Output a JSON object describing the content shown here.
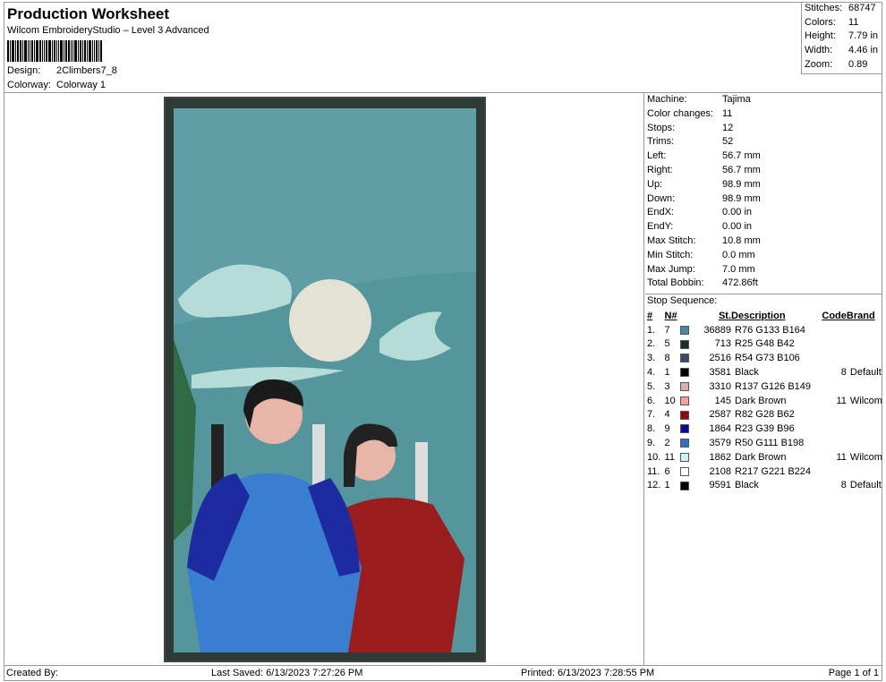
{
  "header": {
    "title": "Production Worksheet",
    "subtitle": "Wilcom EmbroideryStudio – Level 3 Advanced",
    "design_label": "Design:",
    "design": "2Climbers7_8",
    "colorway_label": "Colorway:",
    "colorway": "Colorway 1"
  },
  "stats": [
    {
      "label": "Stitches:",
      "value": "68747"
    },
    {
      "label": "Colors:",
      "value": "11"
    },
    {
      "label": "Height:",
      "value": "7.79 in"
    },
    {
      "label": "Width:",
      "value": "4.46 in"
    },
    {
      "label": "Zoom:",
      "value": "0.89"
    }
  ],
  "info": [
    {
      "label": "Machine:",
      "value": "Tajima"
    },
    {
      "label": "Color changes:",
      "value": "11"
    },
    {
      "label": "Stops:",
      "value": "12"
    },
    {
      "label": "Trims:",
      "value": "52"
    },
    {
      "label": "Left:",
      "value": "56.7 mm"
    },
    {
      "label": "Right:",
      "value": "56.7 mm"
    },
    {
      "label": "Up:",
      "value": "98.9 mm"
    },
    {
      "label": "Down:",
      "value": "98.9 mm"
    },
    {
      "label": "EndX:",
      "value": "0.00 in"
    },
    {
      "label": "EndY:",
      "value": "0.00 in"
    },
    {
      "label": "Max Stitch:",
      "value": "10.8 mm"
    },
    {
      "label": "Min Stitch:",
      "value": "0.0 mm"
    },
    {
      "label": "Max Jump:",
      "value": "7.0 mm"
    },
    {
      "label": "Total Bobbin:",
      "value": "472.86ft"
    }
  ],
  "stop_sequence": {
    "title": "Stop Sequence:",
    "columns": [
      "#",
      "N#",
      "St.",
      "Description",
      "Code",
      "Brand"
    ],
    "rows": [
      {
        "num": "1.",
        "n": "7",
        "color": "#4c85a4",
        "st": "36889",
        "desc": "R76 G133 B164",
        "code": "",
        "brand": ""
      },
      {
        "num": "2.",
        "n": "5",
        "color": "#19302a",
        "st": "713",
        "desc": "R25 G48 B42",
        "code": "",
        "brand": ""
      },
      {
        "num": "3.",
        "n": "8",
        "color": "#36496a",
        "st": "2516",
        "desc": "R54 G73 B106",
        "code": "",
        "brand": ""
      },
      {
        "num": "4.",
        "n": "1",
        "color": "#000000",
        "st": "3581",
        "desc": "Black",
        "code": "8",
        "brand": "Default"
      },
      {
        "num": "5.",
        "n": "3",
        "color": "#e0aab4",
        "st": "3310",
        "desc": "R137 G126 B149",
        "code": "",
        "brand": ""
      },
      {
        "num": "6.",
        "n": "10",
        "color": "#f8a0a0",
        "st": "145",
        "desc": "Dark Brown",
        "code": "11",
        "brand": "Wilcom"
      },
      {
        "num": "7.",
        "n": "4",
        "color": "#8c0a10",
        "st": "2587",
        "desc": "R82 G28 B62",
        "code": "",
        "brand": ""
      },
      {
        "num": "8.",
        "n": "9",
        "color": "#0a0a90",
        "st": "1864",
        "desc": "R23 G39 B96",
        "code": "",
        "brand": ""
      },
      {
        "num": "9.",
        "n": "2",
        "color": "#3070c6",
        "st": "3579",
        "desc": "R50 G111 B198",
        "code": "",
        "brand": ""
      },
      {
        "num": "10.",
        "n": "11",
        "color": "#c8f4f4",
        "st": "1862",
        "desc": "Dark Brown",
        "code": "11",
        "brand": "Wilcom"
      },
      {
        "num": "11.",
        "n": "6",
        "color": "#ffffff",
        "st": "2108",
        "desc": "R217 G221 B224",
        "code": "",
        "brand": ""
      },
      {
        "num": "12.",
        "n": "1",
        "color": "#000000",
        "st": "9591",
        "desc": "Black",
        "code": "8",
        "brand": "Default"
      }
    ]
  },
  "footer": {
    "created": "Created By:",
    "saved": "Last Saved: 6/13/2023 7:27:26 PM",
    "printed": "Printed: 6/13/2023 7:28:55 PM",
    "page": "Page 1 of 1"
  }
}
